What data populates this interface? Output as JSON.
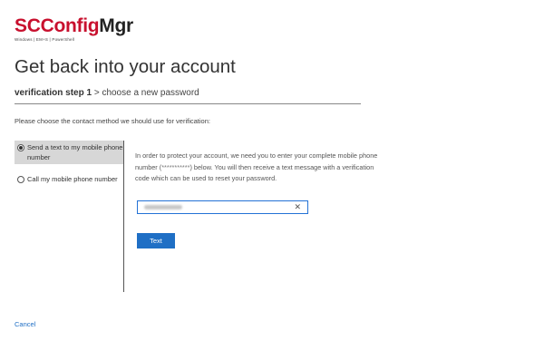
{
  "logo": {
    "part1": "SC",
    "part2": "Config",
    "part3": "Mgr",
    "tagline": "Windows | EM+S | PowerShell"
  },
  "page": {
    "title": "Get back into your account"
  },
  "steps": {
    "current": "verification step 1",
    "separator": ">",
    "next": "choose a new password"
  },
  "instruction": "Please choose the contact method we should use for verification:",
  "methods": [
    {
      "label": "Send a text to my mobile phone number",
      "selected": true
    },
    {
      "label": "Call my mobile phone number",
      "selected": false
    }
  ],
  "details": {
    "text_before": "In order to protect your account, we need you to enter your complete mobile phone number (",
    "masked_number": "***********",
    "text_after": ") below. You will then receive a text message with a verification code which can be used to reset your password."
  },
  "phone_input": {
    "value": "",
    "clear_icon": "close-icon"
  },
  "buttons": {
    "text": "Text"
  },
  "links": {
    "cancel": "Cancel"
  },
  "colors": {
    "brand_red": "#c8102e",
    "accent_blue": "#1f6fc5",
    "selected_bg": "#d7d7d7"
  }
}
